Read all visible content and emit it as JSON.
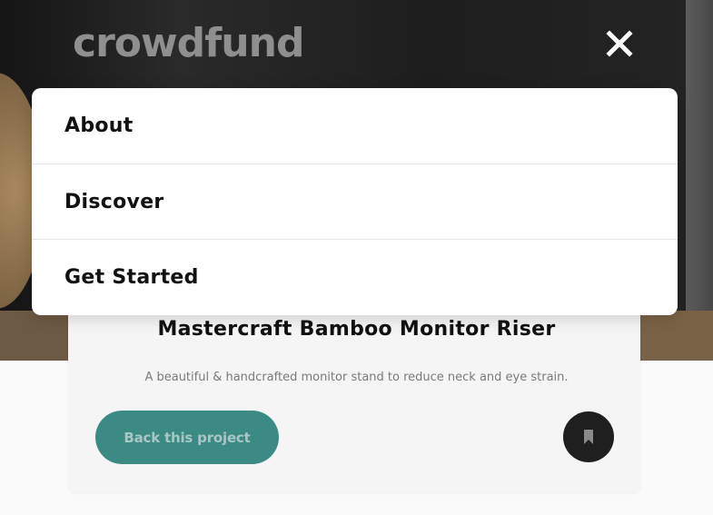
{
  "header": {
    "logo_text": "crowdfund",
    "close_icon": "close-icon"
  },
  "menu": {
    "items": [
      {
        "label": "About"
      },
      {
        "label": "Discover"
      },
      {
        "label": "Get Started"
      }
    ]
  },
  "project": {
    "title": "Mastercraft Bamboo Monitor Riser",
    "description": "A beautiful & handcrafted monitor stand to reduce neck and eye strain.",
    "back_button_label": "Back this project",
    "bookmark_icon": "bookmark-icon"
  },
  "colors": {
    "accent": "#3b8a84",
    "dark": "#1f1f1f"
  }
}
